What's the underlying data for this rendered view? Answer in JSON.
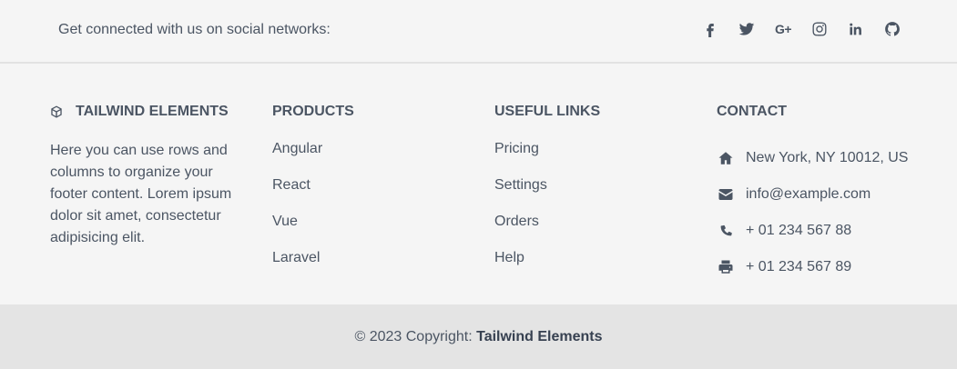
{
  "social": {
    "text": "Get connected with us on social networks:",
    "icons": [
      {
        "name": "facebook-icon"
      },
      {
        "name": "twitter-icon"
      },
      {
        "name": "google-plus-icon",
        "glyph": "G+"
      },
      {
        "name": "instagram-icon"
      },
      {
        "name": "linkedin-icon"
      },
      {
        "name": "github-icon"
      }
    ]
  },
  "brand": {
    "title": "TAILWIND ELEMENTS",
    "icon": "cube-icon",
    "description": "Here you can use rows and columns to organize your footer content. Lorem ipsum dolor sit amet, consectetur adipisicing elit."
  },
  "products": {
    "title": "PRODUCTS",
    "items": [
      "Angular",
      "React",
      "Vue",
      "Laravel"
    ]
  },
  "useful_links": {
    "title": "USEFUL LINKS",
    "items": [
      "Pricing",
      "Settings",
      "Orders",
      "Help"
    ]
  },
  "contact": {
    "title": "CONTACT",
    "items": [
      {
        "icon": "home-icon",
        "text": "New York, NY 10012, US"
      },
      {
        "icon": "envelope-icon",
        "text": "info@example.com"
      },
      {
        "icon": "phone-icon",
        "text": "+ 01 234 567 88"
      },
      {
        "icon": "printer-icon",
        "text": "+ 01 234 567 89"
      }
    ]
  },
  "copyright": {
    "prefix": "© 2023 Copyright: ",
    "link": "Tailwind Elements"
  },
  "colors": {
    "background": "#f5f5f5",
    "copyright_background": "#e4e4e4",
    "text": "#4b5563"
  }
}
